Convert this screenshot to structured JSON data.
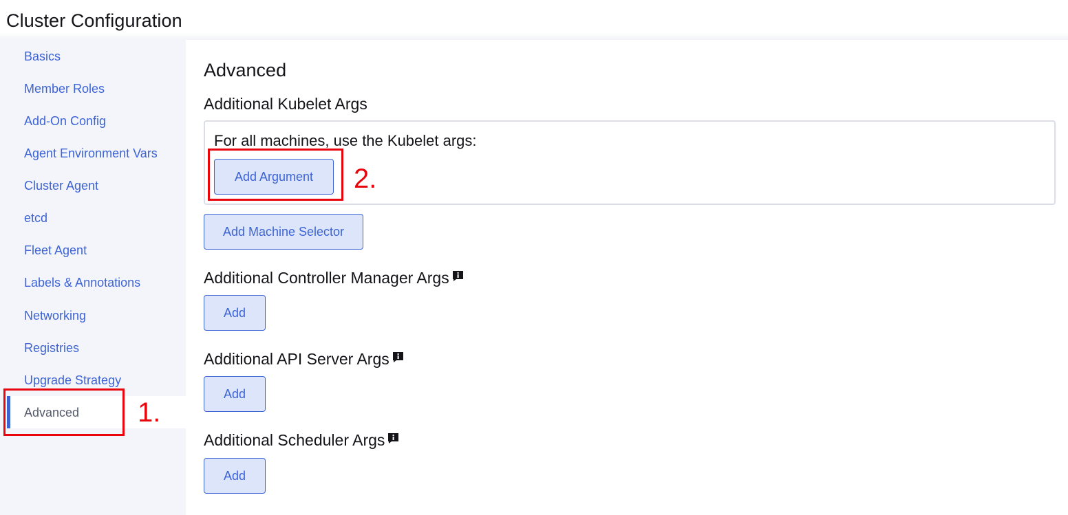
{
  "page": {
    "title": "Cluster Configuration"
  },
  "sidebar": {
    "items": [
      {
        "label": "Basics"
      },
      {
        "label": "Member Roles"
      },
      {
        "label": "Add-On Config"
      },
      {
        "label": "Agent Environment Vars"
      },
      {
        "label": "Cluster Agent"
      },
      {
        "label": "etcd"
      },
      {
        "label": "Fleet Agent"
      },
      {
        "label": "Labels & Annotations"
      },
      {
        "label": "Networking"
      },
      {
        "label": "Registries"
      },
      {
        "label": "Upgrade Strategy"
      }
    ],
    "active": {
      "label": "Advanced"
    }
  },
  "annotations": {
    "step1": "1.",
    "step2": "2."
  },
  "main": {
    "title": "Advanced",
    "kubelet": {
      "heading": "Additional Kubelet Args",
      "description": "For all machines, use the Kubelet args:",
      "add_argument_label": "Add Argument",
      "add_machine_selector_label": "Add Machine Selector"
    },
    "controller_manager": {
      "heading": "Additional Controller Manager Args",
      "add_label": "Add",
      "icon": "info-icon"
    },
    "api_server": {
      "heading": "Additional API Server Args",
      "add_label": "Add",
      "icon": "info-icon"
    },
    "scheduler": {
      "heading": "Additional Scheduler Args",
      "add_label": "Add",
      "icon": "info-icon"
    }
  },
  "colors": {
    "accent": "#3d64d4",
    "annotation": "#e8060c",
    "sidebar_bg": "#f4f5fa",
    "button_bg": "#dde5fa"
  }
}
